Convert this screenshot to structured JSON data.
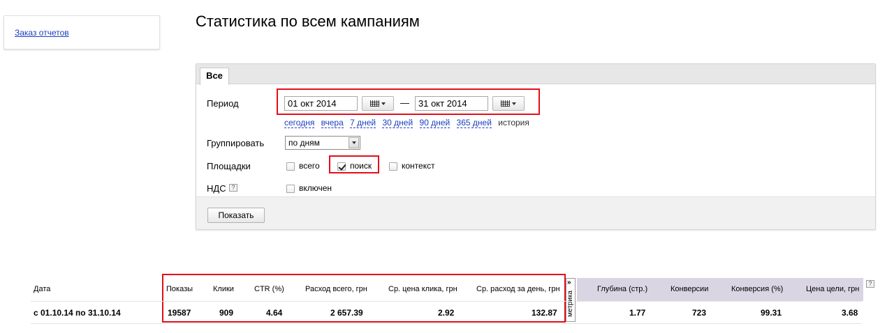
{
  "sidebar": {
    "report_order_link": "Заказ отчетов"
  },
  "page_title": "Статистика по всем кампаниям",
  "filter_panel": {
    "tab_all": "Все",
    "period_label": "Период",
    "date_from": "01 окт 2014",
    "date_to": "31 окт 2014",
    "dash": "—",
    "quick_periods": [
      "сегодня",
      "вчера",
      "7 дней",
      "30 дней",
      "90 дней",
      "365 дней"
    ],
    "history_label": "история",
    "group_label": "Группировать",
    "group_value": "по дням",
    "platforms_label": "Площадки",
    "platform_all": "всего",
    "platform_search": "поиск",
    "platform_context": "контекст",
    "platform_search_checked": true,
    "vat_label": "НДС",
    "vat_help": "?",
    "vat_included": "включен",
    "show_button": "Показать"
  },
  "stats": {
    "headers": {
      "date": "Дата",
      "impressions": "Показы",
      "clicks": "Клики",
      "ctr": "CTR (%)",
      "total_spend": "Расход всего, грн",
      "avg_cpc": "Ср. цена клика, грн",
      "avg_daily_spend": "Ср. расход за день, грн",
      "metrika": "метрика",
      "metrika_arrow": "»",
      "depth": "Глубина (стр.)",
      "conversions": "Конверсии",
      "conversion_rate": "Конверсия (%)",
      "goal_cost": "Цена цели, грн",
      "help": "?"
    },
    "row": {
      "date": "с 01.10.14 по 31.10.14",
      "impressions": "19587",
      "clicks": "909",
      "ctr": "4.64",
      "total_spend": "2 657.39",
      "avg_cpc": "2.92",
      "avg_daily_spend": "132.87",
      "depth": "1.77",
      "conversions": "723",
      "conversion_rate": "99.31",
      "goal_cost": "3.68"
    }
  },
  "colors": {
    "highlight": "#e30d19",
    "link": "#1a3dc1",
    "metrika_header_bg": "#dad5e3"
  }
}
